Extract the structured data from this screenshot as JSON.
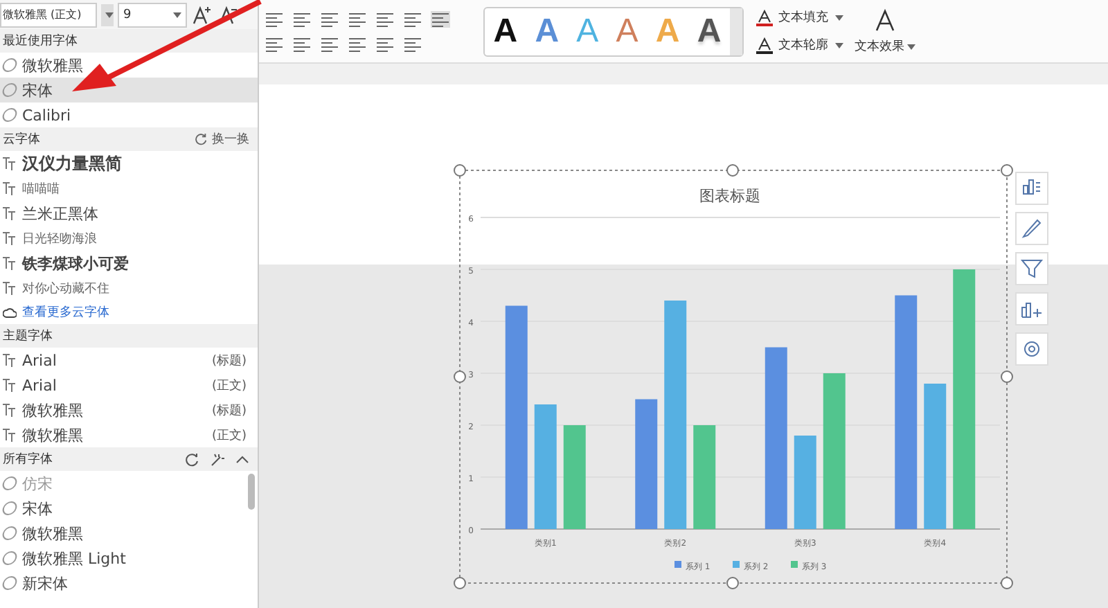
{
  "font_toolbar": {
    "font_name": "微软雅黑 (正文)",
    "font_size": "9"
  },
  "font_panel": {
    "sections": [
      {
        "kind": "recent",
        "title": "最近使用字体",
        "items": [
          {
            "name": "微软雅黑",
            "selected": false
          },
          {
            "name": "宋体",
            "selected": true
          },
          {
            "name": "Calibri",
            "selected": false
          }
        ]
      },
      {
        "kind": "cloud",
        "title": "云字体",
        "action": "换一换",
        "items": [
          {
            "name": "汉仪力量黑简",
            "selected": false
          },
          {
            "name": "喵喵喵",
            "selected": false
          },
          {
            "name": "兰米正黑体",
            "selected": false
          },
          {
            "name": "日光轻吻海浪",
            "selected": false
          },
          {
            "name": "铁李煤球小可爱",
            "selected": false
          },
          {
            "name": "对你心动藏不住",
            "selected": false
          }
        ],
        "more_link": "查看更多云字体"
      },
      {
        "kind": "theme",
        "title": "主题字体",
        "items": [
          {
            "name": "Arial",
            "role": "(标题)",
            "selected": false
          },
          {
            "name": "Arial",
            "role": "(正文)",
            "selected": false
          },
          {
            "name": "微软雅黑",
            "role": "(标题)",
            "selected": false
          },
          {
            "name": "微软雅黑",
            "role": "(正文)",
            "selected": false
          }
        ]
      },
      {
        "kind": "all",
        "title": "所有字体",
        "items": [
          {
            "name": "仿宋",
            "selected": false
          },
          {
            "name": "宋体",
            "selected": false
          },
          {
            "name": "微软雅黑",
            "selected": false
          },
          {
            "name": "微软雅黑 Light",
            "selected": false
          },
          {
            "name": "新宋体",
            "selected": false
          }
        ]
      }
    ]
  },
  "ribbon": {
    "text_styles": [
      {
        "label": "A",
        "kind": "solid",
        "color": "#111111"
      },
      {
        "label": "A",
        "kind": "solid",
        "color": "#5b8fd6"
      },
      {
        "label": "A",
        "kind": "outline",
        "color": "#4fb3e0"
      },
      {
        "label": "A",
        "kind": "outline",
        "color": "#cf7f5c"
      },
      {
        "label": "A",
        "kind": "solid",
        "color": "#eeaa4a"
      },
      {
        "label": "A",
        "kind": "gradient",
        "color": "#555555"
      }
    ],
    "text_fill": "文本填充",
    "text_outline": "文本轮廓",
    "text_effect": "文本效果"
  },
  "chart": {
    "chart_data": {
      "type": "bar",
      "title": "图表标题",
      "categories": [
        "类别1",
        "类别2",
        "类别3",
        "类别4"
      ],
      "series": [
        {
          "name": "系列 1",
          "color": "#5b8fe0",
          "values": [
            4.3,
            2.5,
            3.5,
            4.5
          ]
        },
        {
          "name": "系列 2",
          "color": "#56b0e2",
          "values": [
            2.4,
            4.4,
            1.8,
            2.8
          ]
        },
        {
          "name": "系列 3",
          "color": "#52c58e",
          "values": [
            2,
            2,
            3,
            5
          ]
        }
      ],
      "ylim": [
        0,
        6
      ],
      "yticks": [
        0,
        1,
        2,
        3,
        4,
        5,
        6
      ],
      "grid": true,
      "legend": true
    }
  }
}
